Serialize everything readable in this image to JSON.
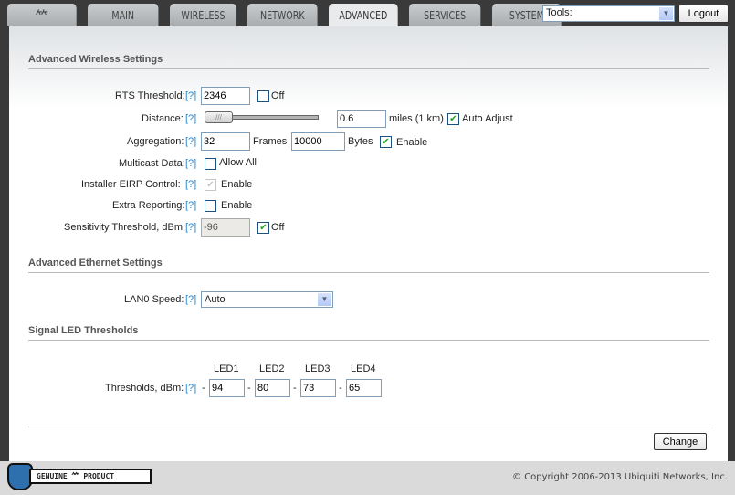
{
  "nav": {
    "tabs": [
      "MAIN",
      "WIRELESS",
      "NETWORK",
      "ADVANCED",
      "SERVICES",
      "SYSTEM"
    ],
    "active": "ADVANCED",
    "tools_label": "Tools:",
    "logout": "Logout"
  },
  "wireless": {
    "title": "Advanced Wireless Settings",
    "help": "[?]",
    "rts_label": "RTS Threshold:",
    "rts_value": "2346",
    "rts_off": "Off",
    "distance_label": "Distance:",
    "distance_value": "0.6",
    "distance_unit": "miles (1 km)",
    "auto_adjust": "Auto Adjust",
    "aggr_label": "Aggregation:",
    "aggr_frames": "32",
    "frames": "Frames",
    "aggr_bytes": "10000",
    "bytes": "Bytes",
    "aggr_enable": "Enable",
    "multicast_label": "Multicast Data:",
    "allow_all": "Allow All",
    "eirp_label": "Installer EIRP Control:",
    "eirp_enable": "Enable",
    "extra_label": "Extra Reporting:",
    "extra_enable": "Enable",
    "sens_label": "Sensitivity Threshold, dBm:",
    "sens_value": "-96",
    "sens_off": "Off"
  },
  "ethernet": {
    "title": "Advanced Ethernet Settings",
    "lan0_label": "LAN0 Speed:",
    "lan0_value": "Auto"
  },
  "led": {
    "title": "Signal LED Thresholds",
    "label": "Thresholds, dBm:",
    "headers": [
      "LED1",
      "LED2",
      "LED3",
      "LED4"
    ],
    "values": [
      "94",
      "80",
      "73",
      "65"
    ],
    "sep": "-"
  },
  "change": "Change",
  "footer": {
    "badge_left": "GENUINE",
    "badge_right": "PRODUCT",
    "copyright": "© Copyright 2006-2013 Ubiquiti Networks, Inc."
  }
}
